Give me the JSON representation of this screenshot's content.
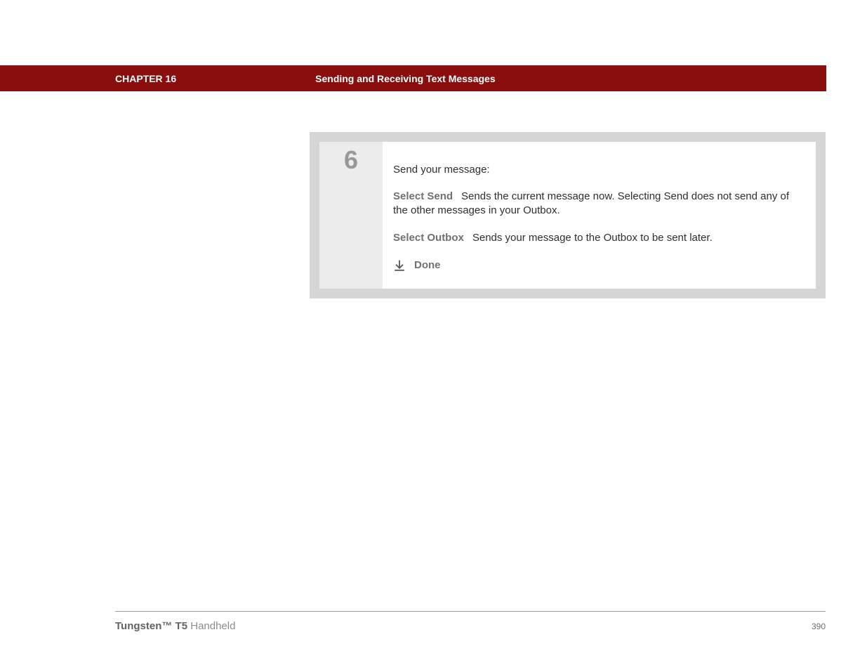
{
  "header": {
    "chapter_label": "CHAPTER 16",
    "chapter_title": "Sending and Receiving Text Messages"
  },
  "step": {
    "number": "6",
    "intro": "Send your message:",
    "options": [
      {
        "label": "Select Send",
        "description": "Sends the current message now. Selecting Send does not send any of the other messages in your Outbox."
      },
      {
        "label": "Select Outbox",
        "description": "Sends your message to the Outbox to be sent later."
      }
    ],
    "done_label": "Done"
  },
  "footer": {
    "product_bold": "Tungsten™ T5",
    "product_rest": " Handheld",
    "page_number": "390"
  }
}
